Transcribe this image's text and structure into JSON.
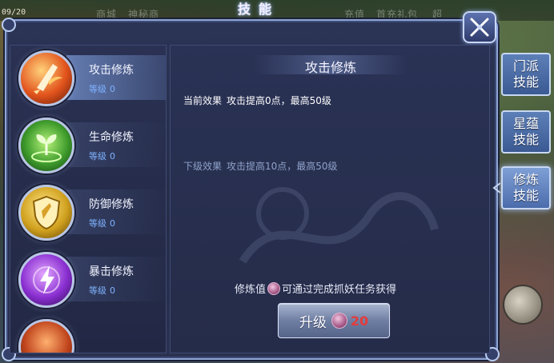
{
  "hud": {
    "time": "09/20",
    "blurred_tabs": [
      "商城",
      "神秘商",
      "充值",
      "首充礼包",
      "超"
    ]
  },
  "window": {
    "title": "技能"
  },
  "skills": [
    {
      "name": "攻击修炼",
      "level_label": "等级",
      "level": "0",
      "icon": "attack-sword-icon",
      "selected": true
    },
    {
      "name": "生命修炼",
      "level_label": "等级",
      "level": "0",
      "icon": "life-sprout-icon",
      "selected": false
    },
    {
      "name": "防御修炼",
      "level_label": "等级",
      "level": "0",
      "icon": "shield-icon",
      "selected": false
    },
    {
      "name": "暴击修炼",
      "level_label": "等级",
      "level": "0",
      "icon": "lightning-icon",
      "selected": false
    }
  ],
  "detail": {
    "title": "攻击修炼",
    "current_label": "当前效果",
    "current_effect": "攻击提高0点，最高50级",
    "next_label": "下级效果",
    "next_effect": "攻击提高10点，最高50级",
    "exp_prefix": "修炼值",
    "exp_suffix": "可通过完成抓妖任务获得",
    "upgrade_label": "升级",
    "upgrade_cost": "20"
  },
  "side_tabs": [
    {
      "line1": "门派",
      "line2": "技能",
      "active": false
    },
    {
      "line1": "星蕴",
      "line2": "技能",
      "active": false
    },
    {
      "line1": "修炼",
      "line2": "技能",
      "active": true
    }
  ],
  "colors": {
    "panel": "#262d48",
    "border": "#8fa6d4",
    "level_text": "#7fb2ff",
    "cost_red": "#e43b3b",
    "tab_blue": "#4b6cab"
  }
}
